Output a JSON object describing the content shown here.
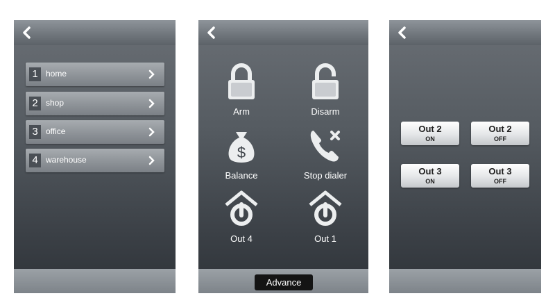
{
  "screen1": {
    "locations": [
      {
        "num": "1",
        "name": "home"
      },
      {
        "num": "2",
        "name": "shop"
      },
      {
        "num": "3",
        "name": "office"
      },
      {
        "num": "4",
        "name": "warehouse"
      }
    ]
  },
  "screen2": {
    "tiles": {
      "arm": "Arm",
      "disarm": "Disarm",
      "balance": "Balance",
      "stop_dialer": "Stop dialer",
      "out4": "Out 4",
      "out1": "Out 1"
    },
    "advance_label": "Advance"
  },
  "screen3": {
    "buttons": [
      {
        "title": "Out 2",
        "state": "ON"
      },
      {
        "title": "Out 2",
        "state": "OFF"
      },
      {
        "title": "Out 3",
        "state": "ON"
      },
      {
        "title": "Out 3",
        "state": "OFF"
      }
    ]
  },
  "icons": [
    "back-chevron-icon",
    "chevron-right-icon",
    "lock-closed-icon",
    "lock-open-icon",
    "money-bag-icon",
    "phone-cancel-icon",
    "house-power-icon"
  ],
  "colors": {
    "screen_top": "#6a6f75",
    "screen_bottom": "#2e3338",
    "row": "#8e9398",
    "button": "#e4e6e8",
    "advance": "#141414"
  }
}
